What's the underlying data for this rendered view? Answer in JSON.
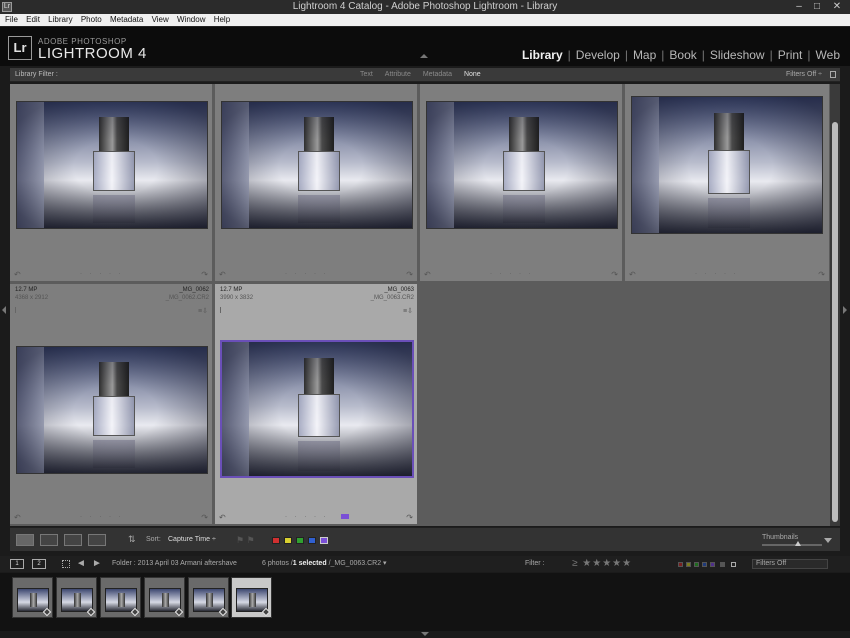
{
  "window": {
    "title": "Lightroom 4 Catalog - Adobe Photoshop Lightroom - Library",
    "app_icon": "Lr"
  },
  "menu": [
    "File",
    "Edit",
    "Library",
    "Photo",
    "Metadata",
    "View",
    "Window",
    "Help"
  ],
  "identity": {
    "logo": "Lr",
    "brand_small": "ADOBE PHOTOSHOP",
    "brand_big": "LIGHTROOM 4"
  },
  "modules": [
    "Library",
    "Develop",
    "Map",
    "Book",
    "Slideshow",
    "Print",
    "Web"
  ],
  "active_module": "Library",
  "library_filter": {
    "label": "Library Filter :",
    "tabs": [
      "Text",
      "Attribute",
      "Metadata",
      "None"
    ],
    "selected_tab": "None",
    "filters_off": "Filters Off ÷"
  },
  "grid": {
    "cells": [
      {
        "mp": "",
        "file": "",
        "dims": "",
        "ext": ""
      },
      {
        "mp": "",
        "file": "",
        "dims": "",
        "ext": ""
      },
      {
        "mp": "",
        "file": "",
        "dims": "",
        "ext": ""
      },
      {
        "mp": "",
        "file": "",
        "dims": "",
        "ext": ""
      },
      {
        "mp": "12.7 MP",
        "file": "_MG_0062",
        "dims": "4368 x 2912",
        "ext": "_MG_0062.CR2"
      },
      {
        "mp": "12.7 MP",
        "file": "_MG_0063",
        "dims": "3990 x 3832",
        "ext": "_MG_0063.CR2"
      }
    ],
    "selected_index": 5,
    "label_color": "#7a4fd6"
  },
  "toolbar": {
    "sort_label": "Sort:",
    "sort_value": "Capture Time ÷",
    "thumbnails_label": "Thumbnails",
    "color_labels": [
      "#d03030",
      "#d8d030",
      "#30a030",
      "#3060d0",
      "#7a4fd6"
    ]
  },
  "filmstrip": {
    "monitor_1": "1",
    "monitor_2": "2",
    "folder": "Folder : 2013 April 03 Armani aftershave",
    "count_prefix": "6 photos /",
    "count_selected": "1 selected",
    "count_suffix": "/_MG_0063.CR2 ▾",
    "filter_label": "Filter :",
    "stars": "≥ ★★★★★",
    "filters_off": "Filters Off",
    "thumb_count": 6,
    "selected_thumb": 5
  }
}
